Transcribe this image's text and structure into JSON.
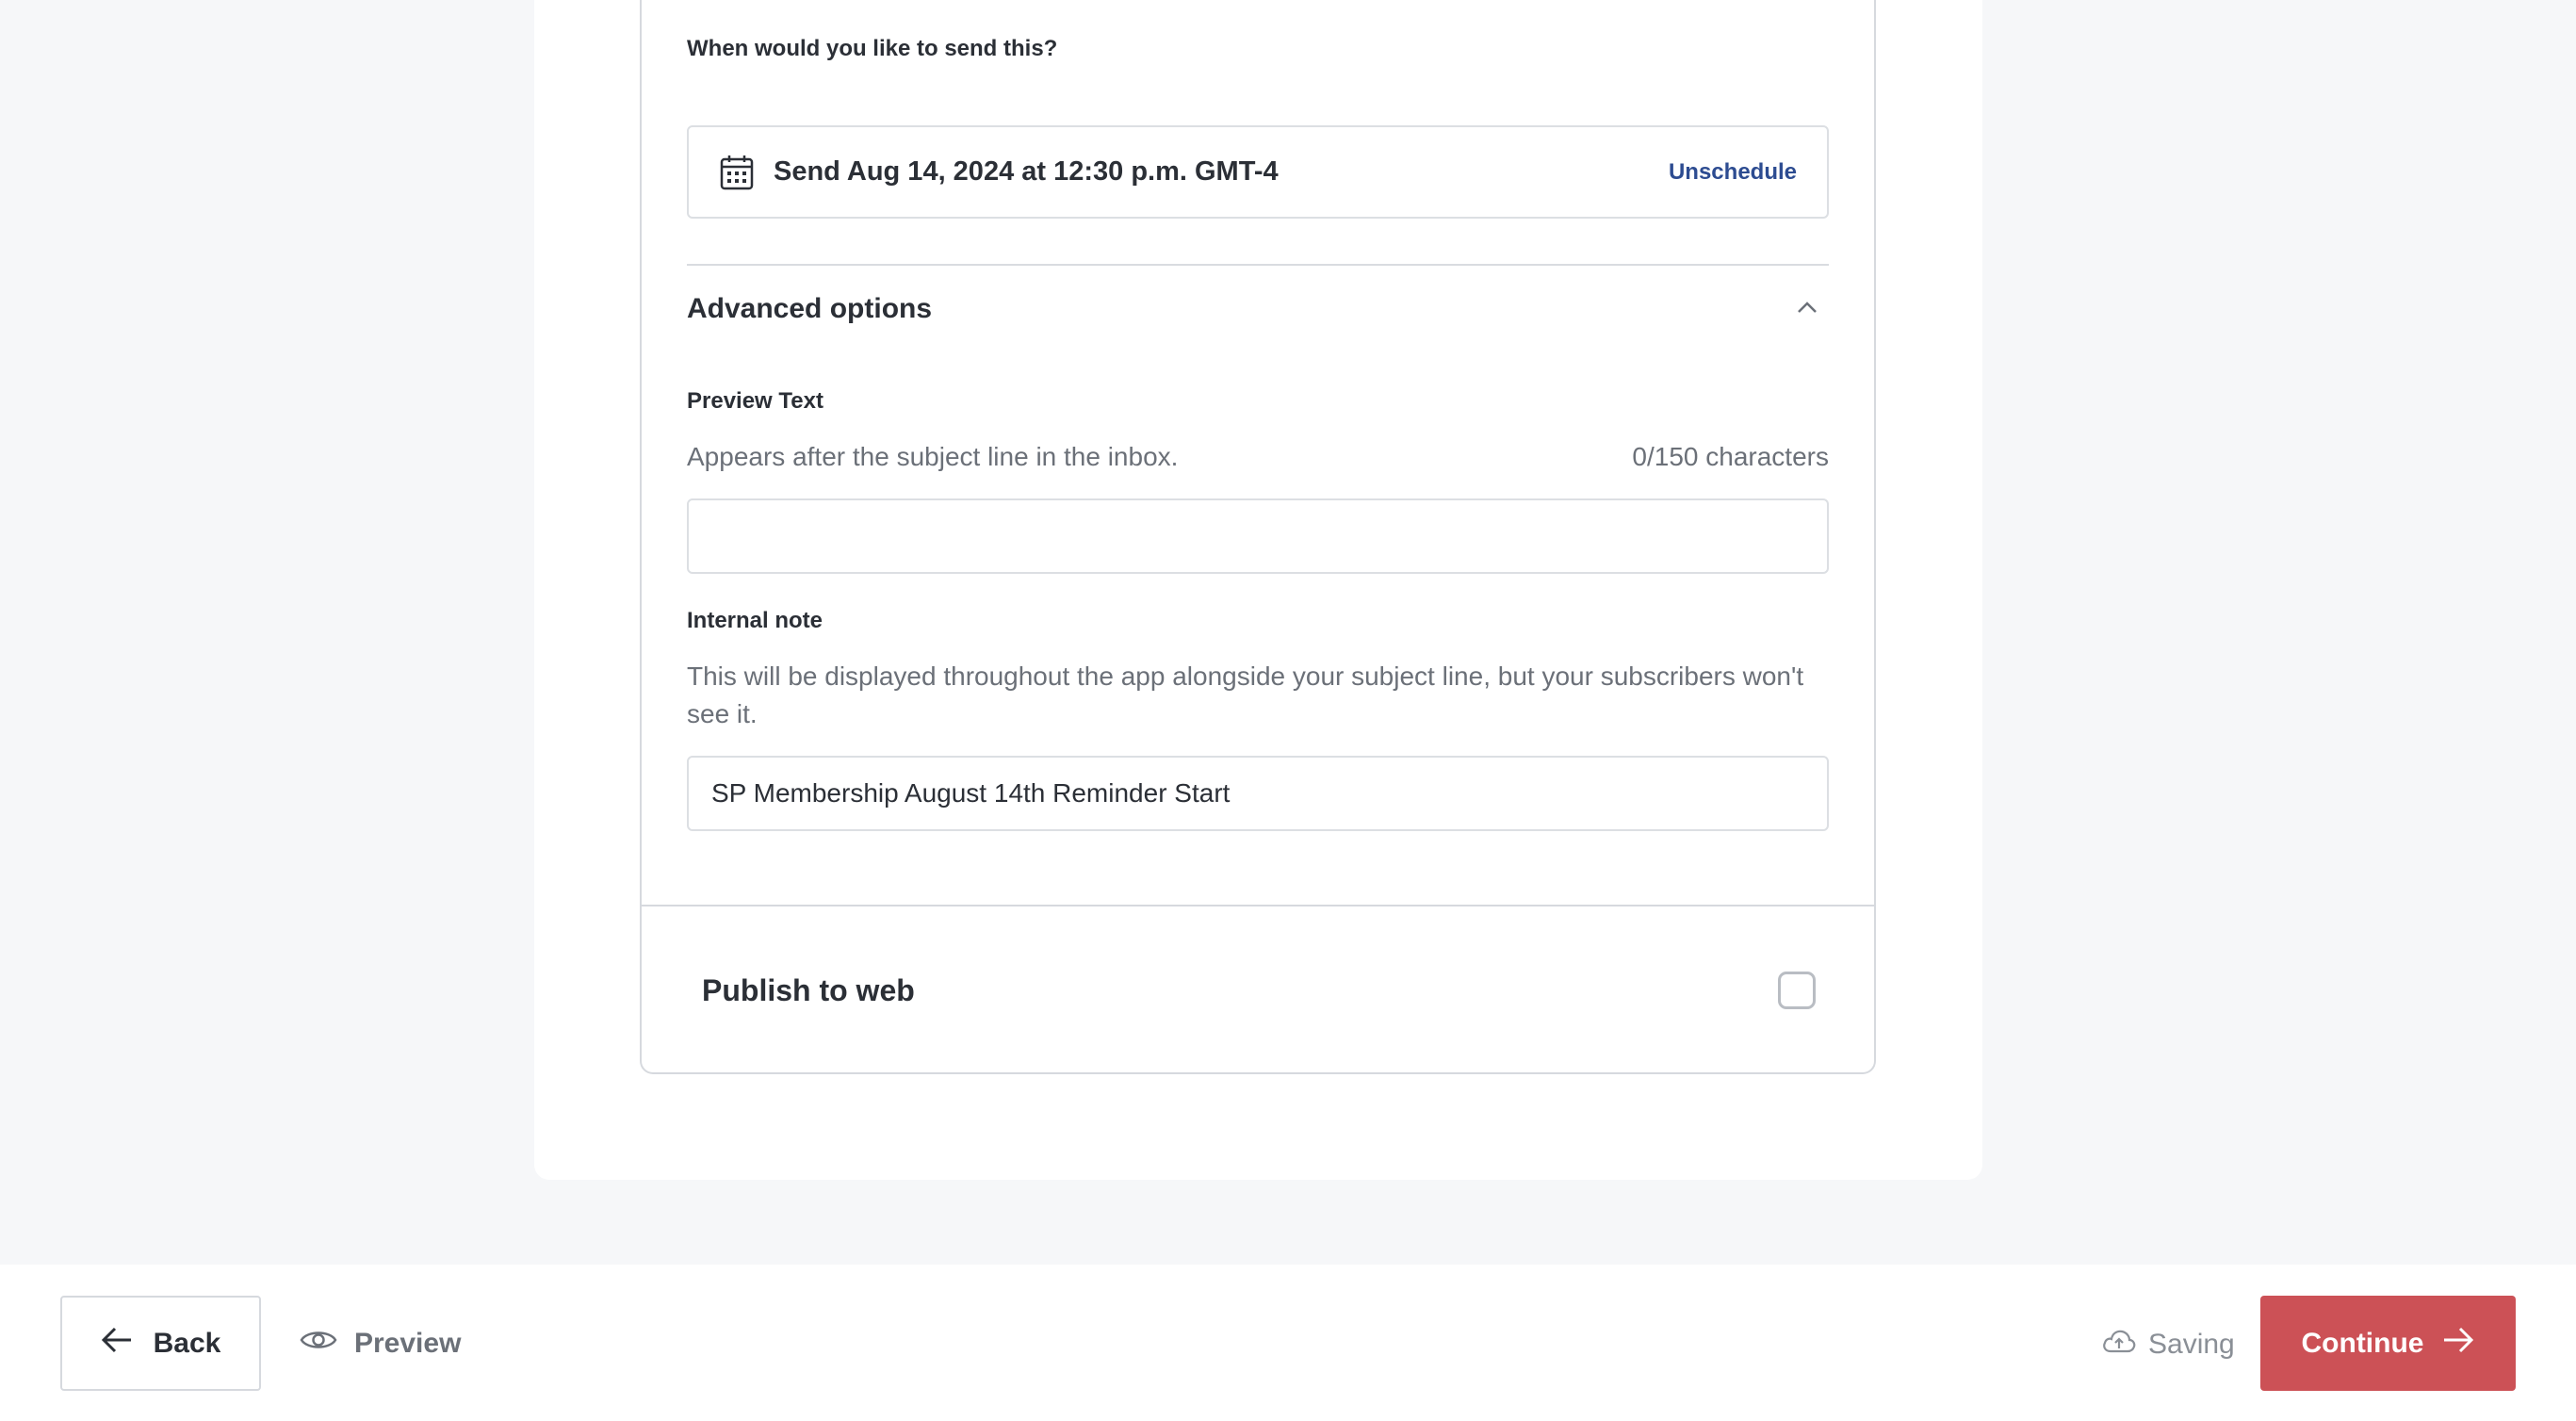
{
  "schedule": {
    "question": "When would you like to send this?",
    "value": "Send Aug 14, 2024 at 12:30 p.m. GMT-4",
    "unschedule_label": "Unschedule"
  },
  "advanced": {
    "title": "Advanced options",
    "expanded": true,
    "preview_text": {
      "label": "Preview Text",
      "help": "Appears after the subject line in the inbox.",
      "counter": "0/150 characters",
      "value": ""
    },
    "internal_note": {
      "label": "Internal note",
      "help": "This will be displayed throughout the app alongside your subject line, but your subscribers won't see it.",
      "value": "SP Membership August 14th Reminder Start"
    }
  },
  "publish": {
    "label": "Publish to web",
    "checked": false
  },
  "footer": {
    "back_label": "Back",
    "preview_label": "Preview",
    "saving_label": "Saving",
    "continue_label": "Continue"
  },
  "colors": {
    "accent": "#cc5156",
    "link": "#2d4c91"
  },
  "icons": {
    "calendar": "calendar-icon",
    "collapse": "chevron-up-icon",
    "back": "arrow-left-icon",
    "preview": "eye-icon",
    "saving": "cloud-upload-icon",
    "continue": "arrow-right-icon"
  }
}
